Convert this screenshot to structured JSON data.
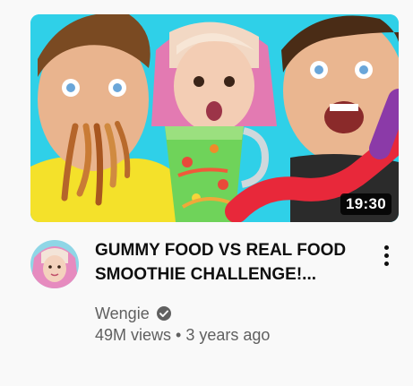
{
  "video": {
    "duration": "19:30",
    "title_line1": "GUMMY FOOD VS REAL FOOD",
    "title_line2": "SMOOTHIE CHALLENGE!...",
    "channel": "Wengie",
    "views": "49M views",
    "separator": "•",
    "age": "3 years ago"
  },
  "icons": {
    "verified": "verified-check-icon",
    "menu": "more-vert-icon"
  },
  "colors": {
    "background": "#f9f9f9",
    "thumbnail_bg": "#2fd0e8",
    "title": "#0f0f0f",
    "secondary_text": "#606060"
  }
}
